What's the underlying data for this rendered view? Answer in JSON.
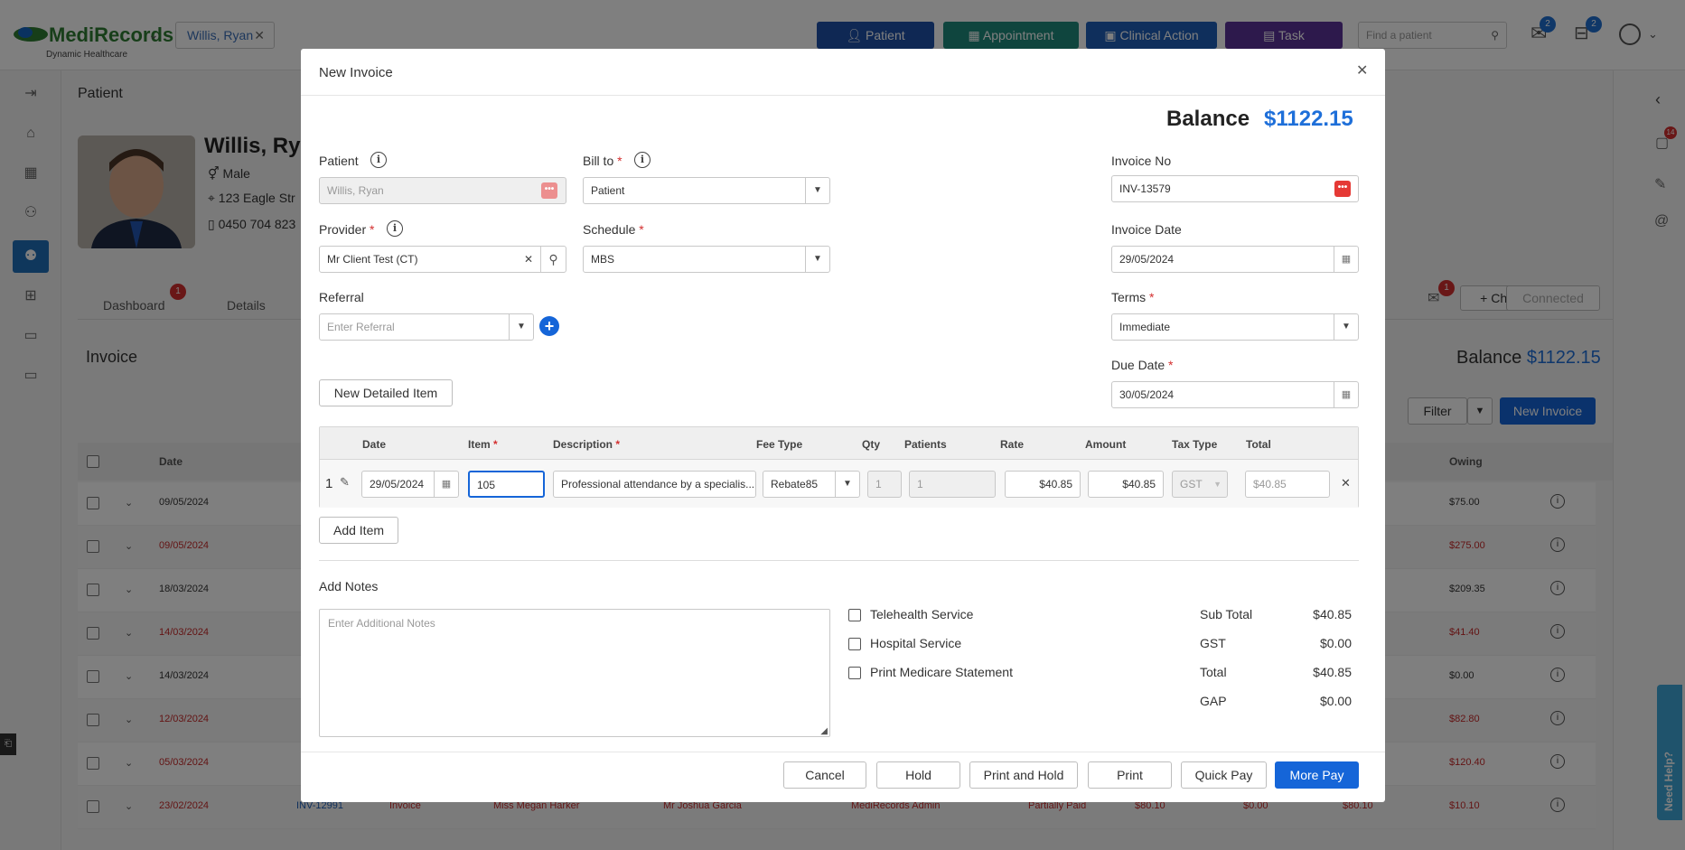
{
  "app": {
    "logo": "MediRecords",
    "logo_sub": "Dynamic Healthcare"
  },
  "topbar": {
    "patient_tag": "Willis, Ryan",
    "buttons": [
      {
        "label": "Patient",
        "color": "#1f50a8"
      },
      {
        "label": "Appointment",
        "color": "#1e8a7d"
      },
      {
        "label": "Clinical Action",
        "color": "#1f5fb8"
      },
      {
        "label": "Task",
        "color": "#5b3399"
      }
    ],
    "search_placeholder": "Find a patient",
    "mail_badge": "2",
    "tray_badge": "2"
  },
  "background": {
    "section_title": "Patient",
    "patient_name": "Willis, Rya",
    "gender": "Male",
    "address": "123 Eagle Str",
    "phone": "0450 704 823",
    "tabs": [
      "Dashboard",
      "Details"
    ],
    "tab_badge": "1",
    "invoice_title": "Invoice",
    "balance_label": "Balance",
    "balance_value": "$1122.15",
    "filter_label": "Filter",
    "new_invoice_label": "New Invoice",
    "chat_label": "Chat",
    "connected_label": "Connected",
    "mail_badge": "1",
    "right_badge": "14",
    "col_date": "Date",
    "col_owing": "Owing",
    "rows": [
      {
        "date": "09/05/2024",
        "owing": "$75.00",
        "red": false
      },
      {
        "date": "09/05/2024",
        "owing": "$275.00",
        "red": true
      },
      {
        "date": "18/03/2024",
        "owing": "$209.35",
        "red": false
      },
      {
        "date": "14/03/2024",
        "owing": "$41.40",
        "red": true
      },
      {
        "date": "14/03/2024",
        "owing": "$0.00",
        "red": false
      },
      {
        "date": "12/03/2024",
        "owing": "$82.80",
        "red": true
      },
      {
        "date": "05/03/2024",
        "owing": "$120.40",
        "red": true
      },
      {
        "date": "23/02/2024",
        "owing": "$10.10",
        "red": true
      }
    ],
    "last_row": {
      "inv": "INV-12991",
      "type": "Invoice",
      "patient": "Miss Megan Harker",
      "provider": "Mr Joshua Garcia",
      "admin": "MediRecords Admin",
      "status": "Partially Paid",
      "a1": "$80.10",
      "a2": "$0.00",
      "a3": "$80.10"
    },
    "need_help": "Need Help?"
  },
  "modal": {
    "title": "New Invoice",
    "balance_label": "Balance",
    "balance_value": "$1122.15",
    "patient_label": "Patient",
    "patient_value": "Willis, Ryan",
    "billto_label": "Bill to",
    "billto_value": "Patient",
    "invoice_no_label": "Invoice No",
    "invoice_no_value": "INV-13579",
    "provider_label": "Provider",
    "provider_value": "Mr Client Test (CT)",
    "schedule_label": "Schedule",
    "schedule_value": "MBS",
    "invoice_date_label": "Invoice Date",
    "invoice_date_value": "29/05/2024",
    "referral_label": "Referral",
    "referral_placeholder": "Enter Referral",
    "terms_label": "Terms",
    "terms_value": "Immediate",
    "due_date_label": "Due Date",
    "due_date_value": "30/05/2024",
    "new_detailed_item": "New Detailed Item",
    "table_headers": [
      "Date",
      "Item",
      "Description",
      "Fee Type",
      "Qty",
      "Patients",
      "Rate",
      "Amount",
      "Tax Type",
      "Total"
    ],
    "line": {
      "num": "1",
      "date": "29/05/2024",
      "item": "105",
      "description": "Professional attendance by a specialis...",
      "fee_type": "Rebate85",
      "qty": "1",
      "patients": "1",
      "rate": "$40.85",
      "amount": "$40.85",
      "tax_type": "GST",
      "total": "$40.85"
    },
    "add_item": "Add Item",
    "add_notes_label": "Add Notes",
    "notes_placeholder": "Enter Additional Notes",
    "checks": [
      "Telehealth Service",
      "Hospital Service",
      "Print Medicare Statement"
    ],
    "summary": [
      {
        "label": "Sub Total",
        "value": "$40.85"
      },
      {
        "label": "GST",
        "value": "$0.00"
      },
      {
        "label": "Total",
        "value": "$40.85"
      },
      {
        "label": "GAP",
        "value": "$0.00"
      }
    ],
    "footer_buttons": [
      "Cancel",
      "Hold",
      "Print and Hold",
      "Print",
      "Quick Pay",
      "More Pay"
    ]
  }
}
